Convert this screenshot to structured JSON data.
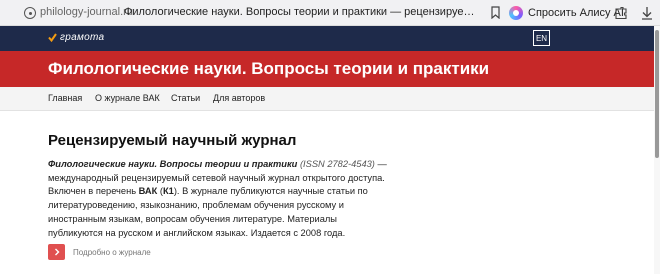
{
  "browser": {
    "domain": "philology-journal.ru",
    "tab_title": "Филологические науки. Вопросы теории и практики — рецензируемый научный жур...",
    "alice_label": "Спросить Алису AI"
  },
  "site": {
    "logo_text": "грамота",
    "lang_button": "EN",
    "banner_title": "Филологические науки. Вопросы теории и практики",
    "nav": [
      "Главная",
      "О журнале ВАК",
      "Статьи",
      "Для авторов"
    ]
  },
  "content": {
    "title": "Рецензируемый научный журнал",
    "journal_name": "Филологические науки. Вопросы теории и практики",
    "issn": "(ISSN 2782-4543)",
    "intro_rest": " — международный рецензируемый сетевой научный журнал открытого доступа. Включен в перечень ",
    "vak": "ВАК",
    "k1_open": " (",
    "k1": "К1",
    "k1_close": "). ",
    "description": "В журнале публикуются научные статьи по литературоведению, языкознанию, проблемам обучения русскому и иностранным языкам, вопросам обучения литературе. Материалы публикуются на русском и английском языках. Издается с 2008 года.",
    "more_label": "Подробно о журнале"
  },
  "colors": {
    "header_bg": "#1e2a4a",
    "banner_bg": "#c62828",
    "more_button": "#e05050"
  }
}
